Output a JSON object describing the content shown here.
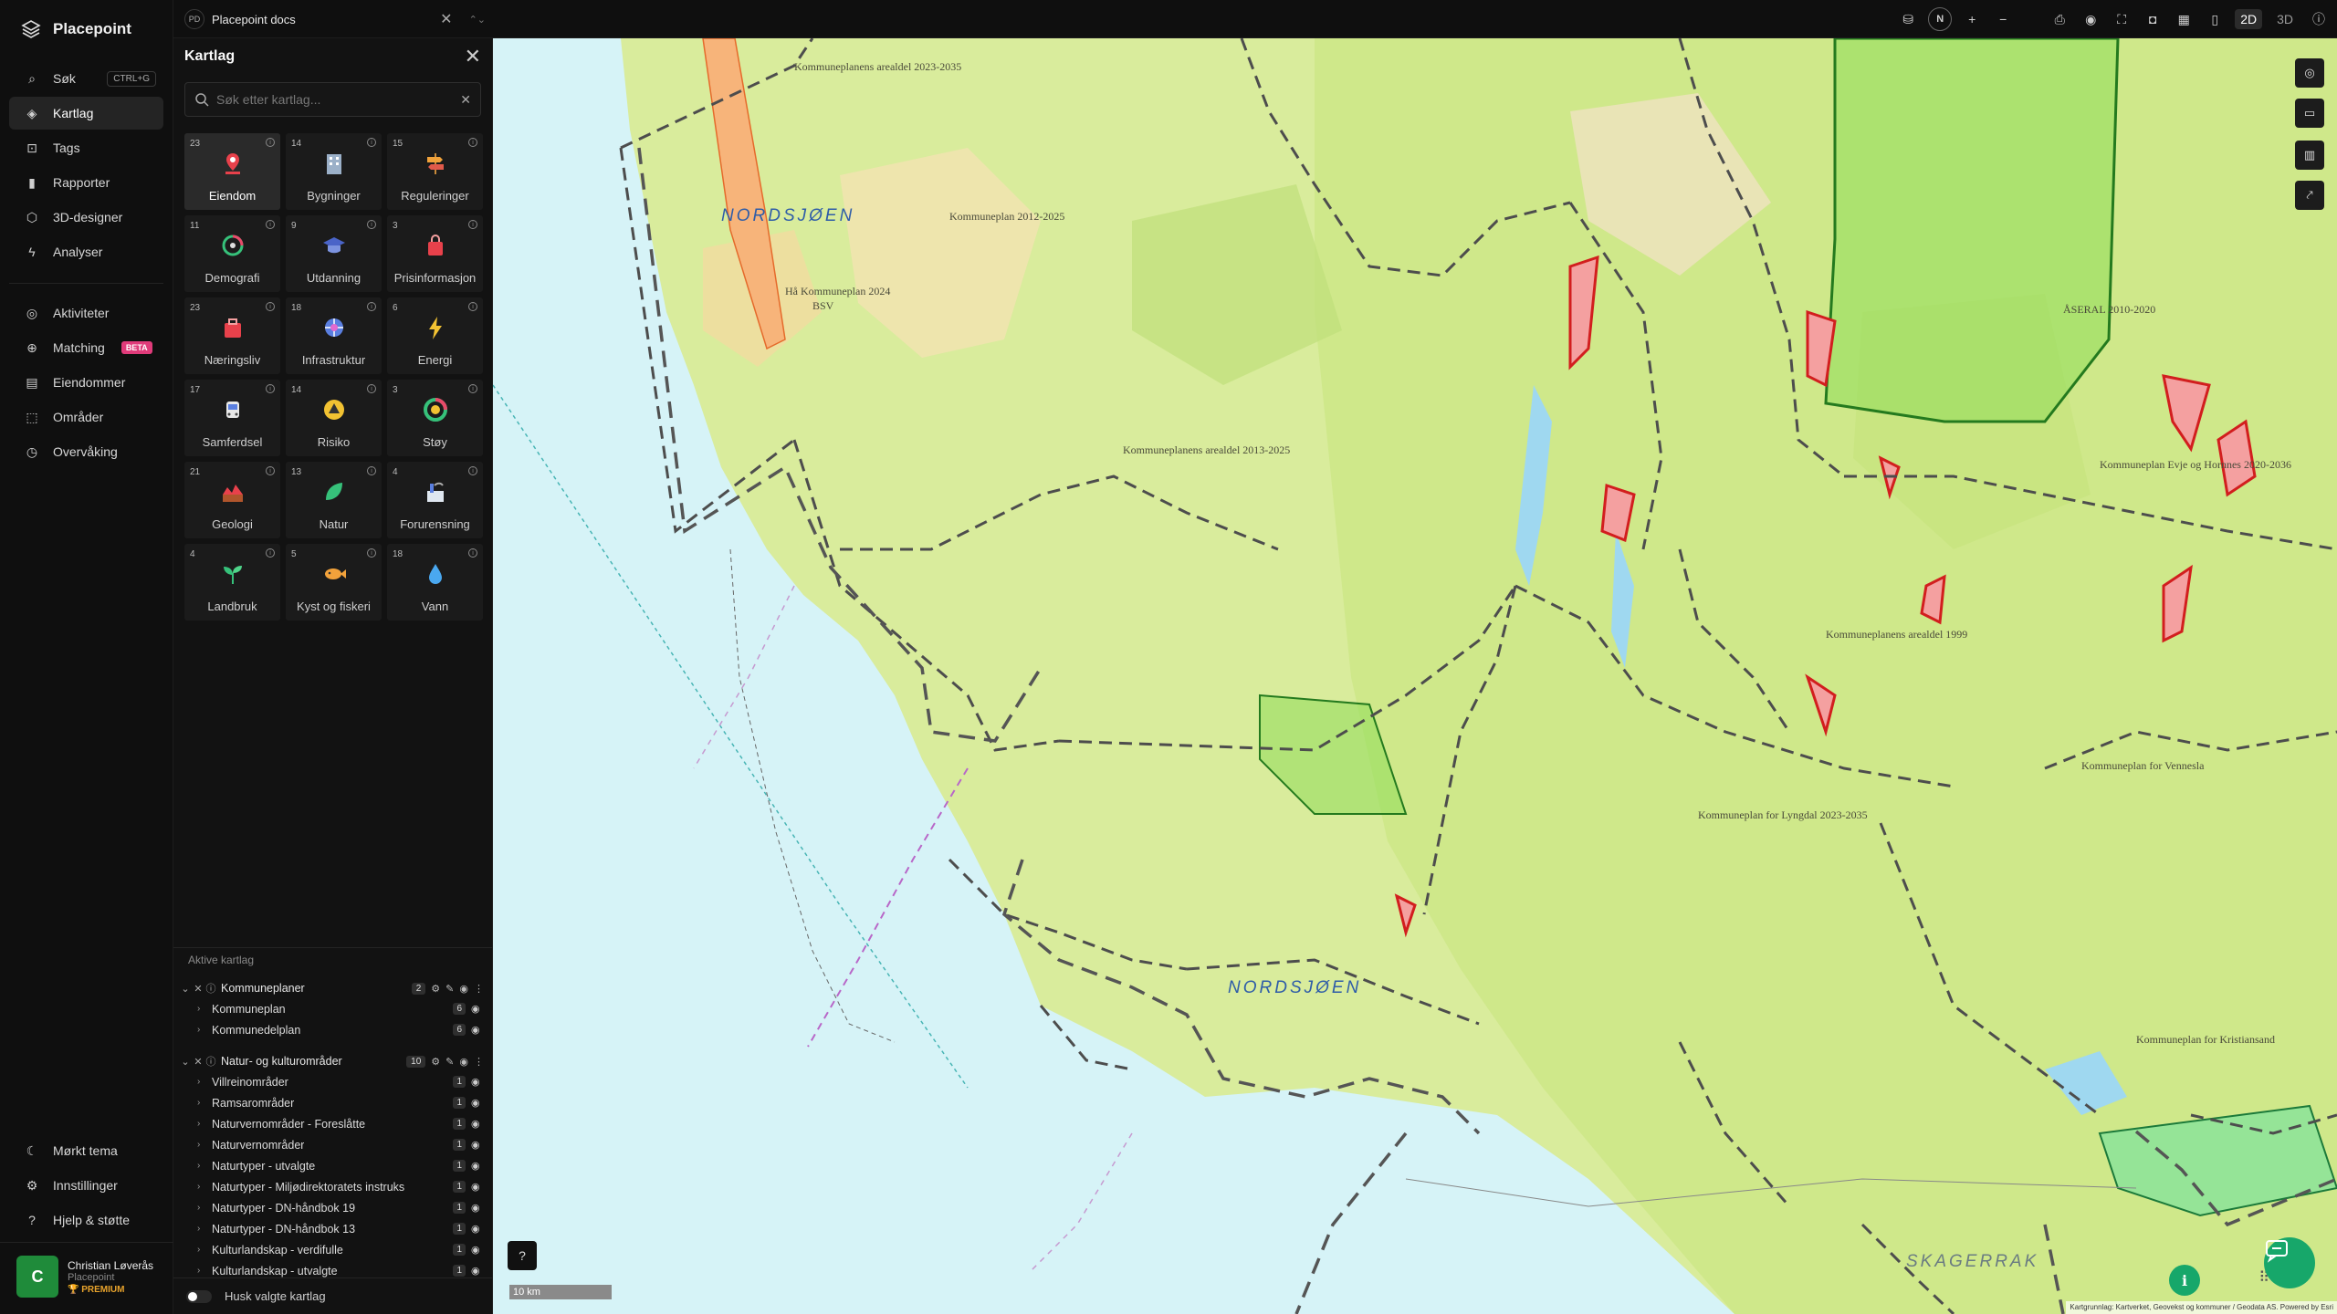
{
  "brand": {
    "name": "Placepoint"
  },
  "nav": {
    "items": [
      {
        "label": "Søk",
        "kbd": "CTRL+G",
        "icon": "search-icon"
      },
      {
        "label": "Kartlag",
        "icon": "layers-icon",
        "active": true
      },
      {
        "label": "Tags",
        "icon": "bookmark-icon"
      },
      {
        "label": "Rapporter",
        "icon": "chart-icon"
      },
      {
        "label": "3D-designer",
        "icon": "cube-icon"
      },
      {
        "label": "Analyser",
        "icon": "bolt-icon"
      }
    ],
    "items2": [
      {
        "label": "Aktiviteter",
        "icon": "activity-icon"
      },
      {
        "label": "Matching",
        "badge": "BETA",
        "icon": "match-icon"
      },
      {
        "label": "Eiendommer",
        "icon": "building-icon"
      },
      {
        "label": "Områder",
        "icon": "area-icon"
      },
      {
        "label": "Overvåking",
        "icon": "monitor-icon"
      }
    ],
    "bottom": [
      {
        "label": "Mørkt tema",
        "icon": "moon-icon"
      },
      {
        "label": "Innstillinger",
        "icon": "gear-icon"
      },
      {
        "label": "Hjelp & støtte",
        "icon": "help-icon"
      }
    ]
  },
  "user": {
    "initial": "C",
    "name": "Christian Løverås",
    "org": "Placepoint",
    "tier": "PREMIUM"
  },
  "topbar": {
    "doc_badge": "PD",
    "doc_title": "Placepoint docs",
    "compass": "N",
    "view_2d": "2D",
    "view_3d": "3D"
  },
  "panel": {
    "title": "Kartlag",
    "search_placeholder": "Søk etter kartlag...",
    "categories": [
      {
        "count": "23",
        "label": "Eiendom",
        "icon": "pin-icon",
        "active": true
      },
      {
        "count": "14",
        "label": "Bygninger",
        "icon": "building-icon"
      },
      {
        "count": "15",
        "label": "Reguleringer",
        "icon": "signpost-icon"
      },
      {
        "count": "11",
        "label": "Demografi",
        "icon": "demography-icon"
      },
      {
        "count": "9",
        "label": "Utdanning",
        "icon": "graduation-icon"
      },
      {
        "count": "3",
        "label": "Prisinformasjon",
        "icon": "price-bag-icon"
      },
      {
        "count": "23",
        "label": "Næringsliv",
        "icon": "business-icon"
      },
      {
        "count": "18",
        "label": "Infrastruktur",
        "icon": "globe-icon"
      },
      {
        "count": "6",
        "label": "Energi",
        "icon": "lightning-icon"
      },
      {
        "count": "17",
        "label": "Samferdsel",
        "icon": "bus-icon"
      },
      {
        "count": "14",
        "label": "Risiko",
        "icon": "hazard-icon"
      },
      {
        "count": "3",
        "label": "Støy",
        "icon": "noise-icon"
      },
      {
        "count": "21",
        "label": "Geologi",
        "icon": "geology-icon"
      },
      {
        "count": "13",
        "label": "Natur",
        "icon": "leaf-icon"
      },
      {
        "count": "4",
        "label": "Forurensning",
        "icon": "factory-icon"
      },
      {
        "count": "4",
        "label": "Landbruk",
        "icon": "plant-icon"
      },
      {
        "count": "5",
        "label": "Kyst og fiskeri",
        "icon": "fish-icon"
      },
      {
        "count": "18",
        "label": "Vann",
        "icon": "water-drop-icon"
      }
    ],
    "active_title": "Aktive kartlag",
    "groups": [
      {
        "name": "Kommuneplaner",
        "count": "2",
        "layers": [
          {
            "name": "Kommuneplan",
            "count": "6"
          },
          {
            "name": "Kommunedelplan",
            "count": "6"
          }
        ]
      },
      {
        "name": "Natur- og kulturområder",
        "count": "10",
        "layers": [
          {
            "name": "Villreinområder",
            "count": "1"
          },
          {
            "name": "Ramsarområder",
            "count": "1"
          },
          {
            "name": "Naturvernområder - Foreslåtte",
            "count": "1"
          },
          {
            "name": "Naturvernområder",
            "count": "1"
          },
          {
            "name": "Naturtyper - utvalgte",
            "count": "1"
          },
          {
            "name": "Naturtyper - Miljødirektoratets instruks",
            "count": "1"
          },
          {
            "name": "Naturtyper - DN-håndbok 19",
            "count": "1"
          },
          {
            "name": "Naturtyper - DN-håndbok 13",
            "count": "1"
          },
          {
            "name": "Kulturlandskap - verdifulle",
            "count": "1"
          },
          {
            "name": "Kulturlandskap - utvalgte",
            "count": "1"
          }
        ]
      }
    ],
    "remember_label": "Husk valgte kartlag"
  },
  "map": {
    "sea_labels": [
      "NORDSJØEN",
      "NORDSJØEN",
      "SKAGERRAK"
    ],
    "plan_labels": [
      "Kommuneplanens arealdel 2023-2035",
      "Kommuneplan 2012-2025",
      "Hå Kommuneplan 2024",
      "BSV",
      "Kommuneplanens arealdel 2013-2025",
      "Kommuneplan for Lyngdal 2023-2035",
      "Kommuneplan for Vennesla",
      "Kommuneplanens arealdel 1999",
      "Kommuneplan Evje og Hornnes 2020-2036",
      "ÅSERAL 2010-2020",
      "Kommuneplan for Kristiansand"
    ],
    "scale": "10 km",
    "attribution": "Kartgrunnlag: Kartverket, Geovekst og kommuner / Geodata AS. Powered by Esri"
  }
}
